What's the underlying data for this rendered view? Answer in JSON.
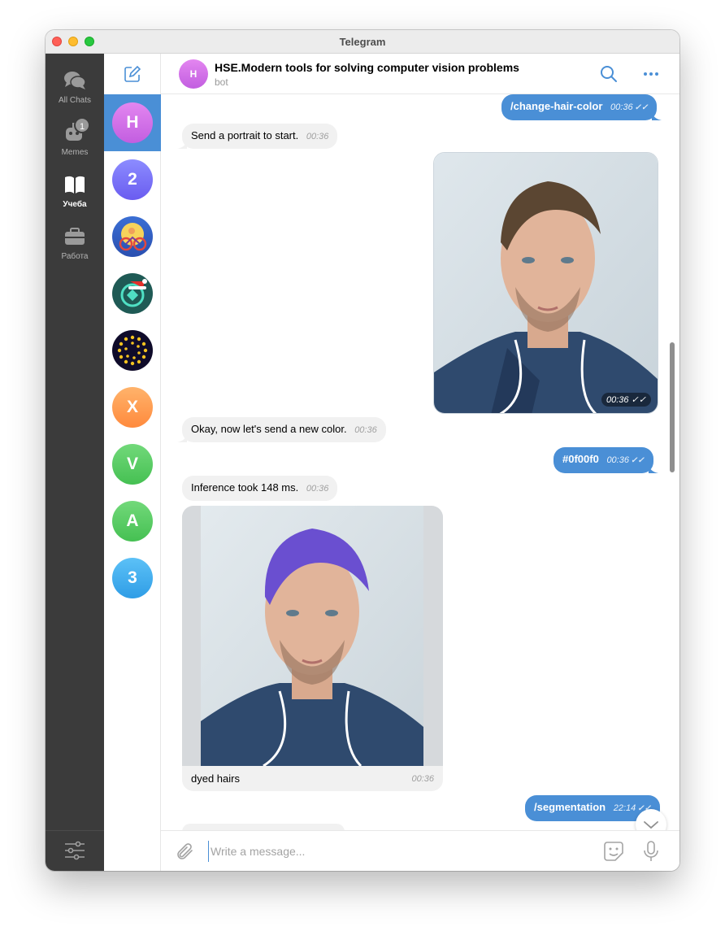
{
  "window": {
    "title": "Telegram"
  },
  "folders": [
    {
      "label": "All Chats",
      "icon": "chats-icon",
      "active": false
    },
    {
      "label": "Memes",
      "icon": "robot-icon",
      "badge": "1",
      "active": false
    },
    {
      "label": "Учеба",
      "icon": "book-icon",
      "active": true
    },
    {
      "label": "Работа",
      "icon": "briefcase-icon",
      "active": false
    }
  ],
  "chat_list": [
    {
      "letter": "H",
      "colors": [
        "#e386f0",
        "#c25ee0"
      ],
      "active": true
    },
    {
      "letter": "2",
      "colors": [
        "#8c8cff",
        "#6a5cf0"
      ]
    },
    {
      "letter": "",
      "image": "bicycle-moon-avatar"
    },
    {
      "letter": "",
      "image": "teal-santa-avatar"
    },
    {
      "letter": "",
      "image": "dotted-ring-avatar"
    },
    {
      "letter": "X",
      "colors": [
        "#ffb36b",
        "#ff8a3d"
      ]
    },
    {
      "letter": "V",
      "colors": [
        "#72d97a",
        "#45c052"
      ]
    },
    {
      "letter": "A",
      "colors": [
        "#72d97a",
        "#45c052"
      ]
    },
    {
      "letter": "3",
      "colors": [
        "#5cc1f7",
        "#2f9de6"
      ]
    }
  ],
  "header": {
    "avatar_letter": "H",
    "title": "HSE.Modern tools for solving computer vision problems",
    "subtitle": "bot"
  },
  "messages": {
    "m1": {
      "text": "/change-hair-color",
      "time": "00:36"
    },
    "m2": {
      "text": "Send a portrait to start.",
      "time": "00:36"
    },
    "m3": {
      "time": "00:36"
    },
    "m4": {
      "text": "Okay, now let's send a new color.",
      "time": "00:36"
    },
    "m5": {
      "text": "#0f00f0",
      "time": "00:36"
    },
    "m6": {
      "text": "Inference took 148 ms.",
      "time": "00:36"
    },
    "m7": {
      "caption": "dyed hairs",
      "time": "00:36"
    },
    "m8": {
      "text": "/segmentation",
      "time": "22:14"
    }
  },
  "composer": {
    "placeholder": "Write a message..."
  },
  "colors": {
    "accent": "#4a8fd6",
    "sidebar": "#3b3b3b",
    "bubble_in": "#f1f1f1"
  }
}
